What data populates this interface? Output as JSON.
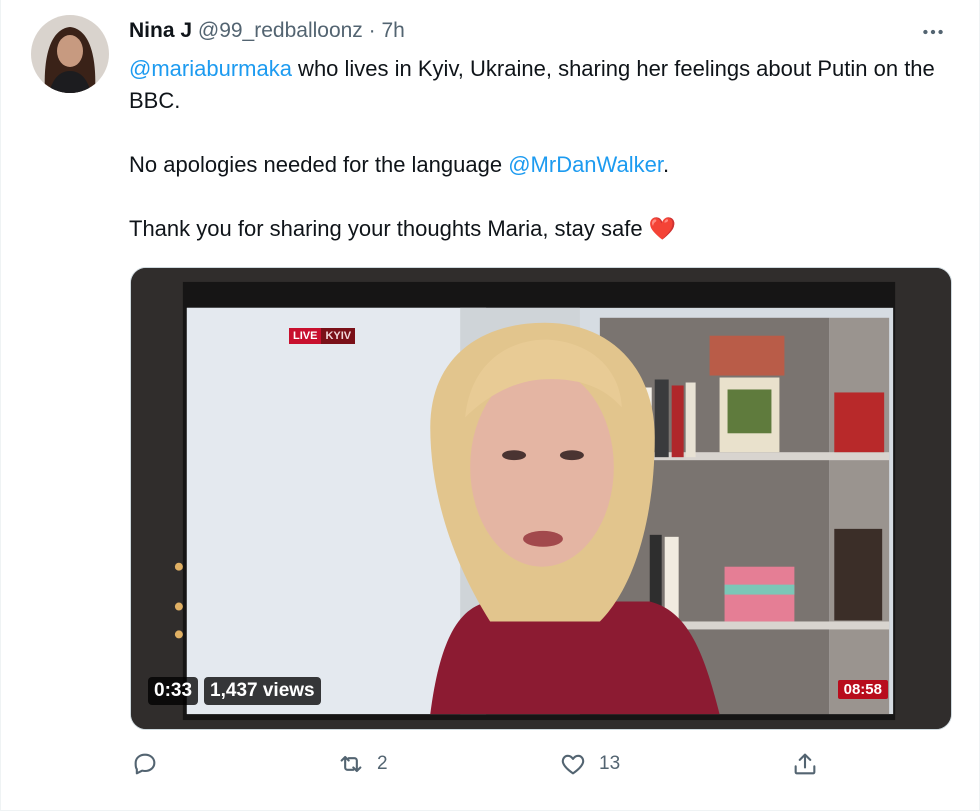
{
  "tweet": {
    "display_name": "Nina J",
    "handle": "@99_redballoonz",
    "separator": "·",
    "time": "7h",
    "more_label": "•••",
    "text": {
      "line1_mention": "@mariaburmaka",
      "line1_rest": " who lives in Kyiv, Ukraine, sharing her feelings about Putin on the BBC.",
      "line2_before": "No apologies needed for the language ",
      "line2_mention": "@MrDanWalker",
      "line2_after": ".",
      "line3": "Thank you for sharing your thoughts Maria, stay safe ",
      "line3_emoji": "❤️"
    }
  },
  "video": {
    "live_label": "LIVE",
    "location_label": "KYIV",
    "clock": "08:58",
    "duration": "0:33",
    "views": "1,437 views"
  },
  "actions": {
    "reply_count": "",
    "retweet_count": "2",
    "like_count": "13",
    "share_count": ""
  },
  "colors": {
    "accent": "#1d9bf0",
    "secondary_text": "#536471",
    "heart": "#e0245e"
  }
}
